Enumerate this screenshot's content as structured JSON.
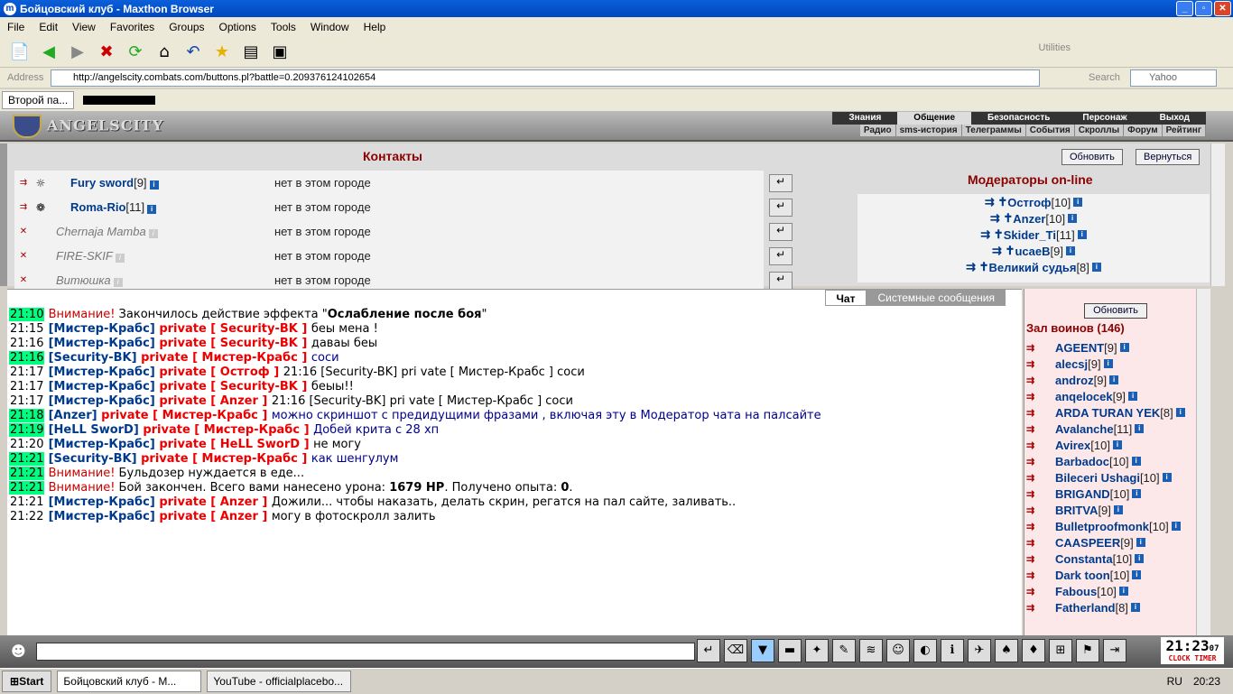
{
  "window": {
    "title": "Бойцовский клуб - Maxthon Browser"
  },
  "menu": [
    "File",
    "Edit",
    "View",
    "Favorites",
    "Groups",
    "Options",
    "Tools",
    "Window",
    "Help"
  ],
  "toolbar": {
    "utilities": "Utilities"
  },
  "address": {
    "label": "Address",
    "url": "http://angelscity.combats.com/buttons.pl?battle=0.209376124102654",
    "search_label": "Search",
    "search_placeholder": "Yahoo"
  },
  "tabs": [
    "Второй па..."
  ],
  "site": {
    "logo": "ANGELSCITY",
    "nav_main": [
      "Знания",
      "Общение",
      "Безопасность",
      "Персонаж",
      "Выход"
    ],
    "nav_sub": [
      "Радио",
      "sms-история",
      "Телеграммы",
      "События",
      "Скроллы",
      "Форум",
      "Рейтинг"
    ]
  },
  "contacts": {
    "title": "Контакты",
    "refresh": "Обновить",
    "back": "Вернуться",
    "moderators_title": "Модераторы on-line",
    "rows": [
      {
        "name": "Fury sword",
        "level": "[9]",
        "location": "нет в этом городе",
        "online": true
      },
      {
        "name": "Roma-Rio",
        "level": "[11]",
        "location": "нет в этом городе",
        "online": true
      },
      {
        "name": "Chernaja Mamba",
        "level": "",
        "location": "нет в этом городе",
        "online": false
      },
      {
        "name": "FIRE-SKIF",
        "level": "",
        "location": "нет в этом городе",
        "online": false
      },
      {
        "name": "Витюшка",
        "level": "",
        "location": "нет в этом городе",
        "online": false
      }
    ],
    "moderators": [
      {
        "name": "Остгоф",
        "level": "[10]"
      },
      {
        "name": "Anzer",
        "level": "[10]"
      },
      {
        "name": "Skider_Ti",
        "level": "[11]"
      },
      {
        "name": "ucaeB",
        "level": "[9]"
      },
      {
        "name": "Великий судья",
        "level": "[8]"
      }
    ]
  },
  "chat": {
    "tabs": [
      "Чат",
      "Системные сообщения"
    ],
    "messages": [
      {
        "time": "21:10",
        "hl": true,
        "parts": [
          [
            "warn",
            "Внимание! "
          ],
          [
            "txt",
            "Закончилось действие эффекта \""
          ],
          [
            "bold",
            "Ослабление после боя"
          ],
          [
            "txt",
            "\""
          ]
        ]
      },
      {
        "time": "21:15",
        "hl": false,
        "parts": [
          [
            "usr",
            "[Мистер-Крабс]"
          ],
          [
            "pv",
            " private [ Security-BK ] "
          ],
          [
            "txt",
            "беы мена !"
          ]
        ]
      },
      {
        "time": "21:16",
        "hl": false,
        "parts": [
          [
            "usr",
            "[Мистер-Крабс]"
          ],
          [
            "pv",
            " private [ Security-BK ] "
          ],
          [
            "txt",
            "даваы беы"
          ]
        ]
      },
      {
        "time": "21:16",
        "hl": true,
        "parts": [
          [
            "usr",
            "[Security-BK]"
          ],
          [
            "pv",
            " private [ Мистер-Крабс ] "
          ],
          [
            "txtb",
            "соси"
          ]
        ]
      },
      {
        "time": "21:17",
        "hl": false,
        "parts": [
          [
            "usr",
            "[Мистер-Крабс]"
          ],
          [
            "pv",
            " private [ Остгоф ] "
          ],
          [
            "txt",
            "21:16 [Security-BK] pri vate [ Мистер-Крабс ] соси"
          ]
        ]
      },
      {
        "time": "21:17",
        "hl": false,
        "parts": [
          [
            "usr",
            "[Мистер-Крабс]"
          ],
          [
            "pv",
            " private [ Security-BK ] "
          ],
          [
            "txt",
            "беыы!!"
          ]
        ]
      },
      {
        "time": "21:17",
        "hl": false,
        "parts": [
          [
            "usr",
            "[Мистер-Крабс]"
          ],
          [
            "pv",
            " private [ Anzer ] "
          ],
          [
            "txt",
            "21:16 [Security-BK] pri vate [ Мистер-Крабс ] соси"
          ]
        ]
      },
      {
        "time": "21:18",
        "hl": true,
        "parts": [
          [
            "usr",
            "[Anzer]"
          ],
          [
            "pv",
            " private [ Мистер-Крабс ] "
          ],
          [
            "txtb",
            "можно скриншот с предидущими фразами , включая эту в Модератор чата на палсайте"
          ]
        ]
      },
      {
        "time": "21:19",
        "hl": true,
        "parts": [
          [
            "usr",
            "[HeLL SworD]"
          ],
          [
            "pv",
            " private [ Мистер-Крабс ] "
          ],
          [
            "txtb",
            "Добей крита с 28 хп"
          ]
        ]
      },
      {
        "time": "21:20",
        "hl": false,
        "parts": [
          [
            "usr",
            "[Мистер-Крабс]"
          ],
          [
            "pv",
            " private [ HeLL SworD ] "
          ],
          [
            "txt",
            "не могу"
          ]
        ]
      },
      {
        "time": "21:21",
        "hl": true,
        "parts": [
          [
            "usr",
            "[Security-BK]"
          ],
          [
            "pv",
            " private [ Мистер-Крабс ] "
          ],
          [
            "txtb",
            "как шенгулум"
          ]
        ]
      },
      {
        "time": "21:21",
        "hl": true,
        "parts": [
          [
            "warn",
            "Внимание! "
          ],
          [
            "txt",
            "Бульдозер нуждается в еде..."
          ]
        ]
      },
      {
        "time": "21:21",
        "hl": true,
        "parts": [
          [
            "warn",
            "Внимание! "
          ],
          [
            "txt",
            "Бой закончен. Всего вами нанесено урона: "
          ],
          [
            "bold",
            "1679 HP"
          ],
          [
            "txt",
            ". Получено опыта: "
          ],
          [
            "bold",
            "0"
          ],
          [
            "txt",
            "."
          ]
        ]
      },
      {
        "time": "21:21",
        "hl": false,
        "parts": [
          [
            "usr",
            "[Мистер-Крабс]"
          ],
          [
            "pv",
            " private [ Anzer ] "
          ],
          [
            "txt",
            "Дожили... чтобы наказать, делать скрин, регатся на пал сайте, заливать.."
          ]
        ]
      },
      {
        "time": "21:22",
        "hl": false,
        "parts": [
          [
            "usr",
            "[Мистер-Крабс]"
          ],
          [
            "pv",
            " private [ Anzer ] "
          ],
          [
            "txt",
            "могу в фотоскролл залить"
          ]
        ]
      }
    ]
  },
  "room": {
    "refresh": "Обновить",
    "title": "Зал воинов (146)",
    "warriors": [
      {
        "name": "AGEENT",
        "level": "[9]"
      },
      {
        "name": "alecsj",
        "level": "[9]"
      },
      {
        "name": "androz",
        "level": "[9]"
      },
      {
        "name": "anqelocek",
        "level": "[9]"
      },
      {
        "name": "ARDA TURAN YEK",
        "level": "[8]"
      },
      {
        "name": "Avalanche",
        "level": "[11]"
      },
      {
        "name": "Avirex",
        "level": "[10]"
      },
      {
        "name": "Barbadoc",
        "level": "[10]"
      },
      {
        "name": "Bileceri Ushagi",
        "level": "[10]"
      },
      {
        "name": "BRIGAND",
        "level": "[10]"
      },
      {
        "name": "BRITVA",
        "level": "[9]"
      },
      {
        "name": "Bulletproofmonk",
        "level": "[10]"
      },
      {
        "name": "CAASPEER",
        "level": "[9]"
      },
      {
        "name": "Constanta",
        "level": "[10]"
      },
      {
        "name": "Dark toon",
        "level": "[10]"
      },
      {
        "name": "Fabous",
        "level": "[10]"
      },
      {
        "name": "Fatherland",
        "level": "[8]"
      }
    ]
  },
  "clock": {
    "time": "21:23",
    "seconds": "07",
    "label": "CLOCK TIMER"
  },
  "taskbar": {
    "start": "Start",
    "tasks": [
      "Бойцовский клуб - M...",
      "YouTube - officialplacebo..."
    ],
    "lang": "RU",
    "time": "20:23"
  }
}
